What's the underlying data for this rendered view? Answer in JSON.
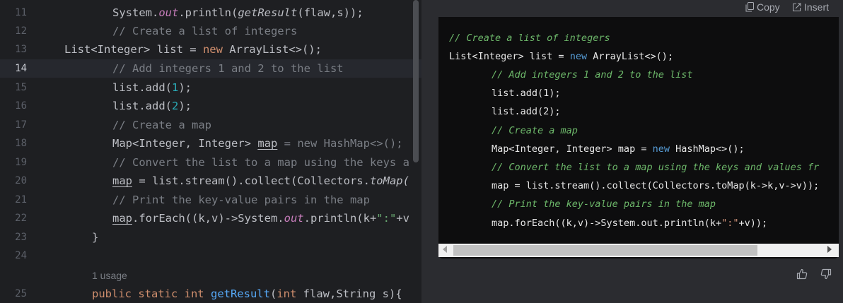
{
  "editor": {
    "line_numbers": [
      "11",
      "12",
      "13",
      "14",
      "15",
      "16",
      "17",
      "18",
      "19",
      "20",
      "21",
      "22",
      "23",
      "24",
      "25"
    ],
    "active_line": "14",
    "usage_hint": "1 usage",
    "lines": {
      "l11": {
        "a": "System.",
        "b": "out",
        "c": ".println(",
        "d": "getResult",
        "e": "(flaw,s));"
      },
      "l12": "// Create a list of integers",
      "l13": {
        "a": "List<Integer> list = ",
        "b": "new",
        "c": " ArrayList<>();"
      },
      "l14": "// Add integers 1 and 2 to the list",
      "l15": {
        "a": "list.add(",
        "b": "1",
        "c": ");"
      },
      "l16": {
        "a": "list.add(",
        "b": "2",
        "c": ");"
      },
      "l17": "// Create a map",
      "l18": {
        "a": "Map<Integer, Integer> ",
        "b": "map",
        "c": " = ",
        "d": "new HashMap<>();"
      },
      "l19": "// Convert the list to a map using the keys a",
      "l20": {
        "a": "map",
        "b": " = list.stream().collect(Collectors.",
        "c": "toMap("
      },
      "l21": "// Print the key-value pairs in the map",
      "l22": {
        "a": "map",
        "b": ".forEach((k,v)->System.",
        "c": "out",
        "d": ".println(k+",
        "e": "\":\"",
        "f": "+v"
      },
      "l23": "}",
      "l25": {
        "a": "public static int ",
        "b": "getResult",
        "c": "(",
        "d": "int",
        "e": " flaw,String s){"
      }
    }
  },
  "chat": {
    "copy_label": "Copy",
    "insert_label": "Insert",
    "code": {
      "c1": "// Create a list of integers",
      "c2": {
        "a": "List<Integer> list = ",
        "b": "new",
        "c": " ArrayList<>();"
      },
      "c3": "// Add integers 1 and 2 to the list",
      "c4": "list.add(1);",
      "c5": "list.add(2);",
      "c6": "// Create a map",
      "c7": {
        "a": "Map<Integer, Integer> map = ",
        "b": "new",
        "c": " HashMap<>();"
      },
      "c8": "// Convert the list to a map using the keys and values fr",
      "c9": "map = list.stream().collect(Collectors.toMap(k->k,v->v));",
      "c10": "// Print the key-value pairs in the map",
      "c11": {
        "a": "map.forEach((k,v)->System.out.println(k+",
        "b": "\":\"",
        "c": "+v));"
      }
    },
    "icons": {
      "copy": "copy-icon",
      "insert": "insert-icon",
      "like": "thumbs-up-icon",
      "dislike": "thumbs-down-icon"
    }
  }
}
